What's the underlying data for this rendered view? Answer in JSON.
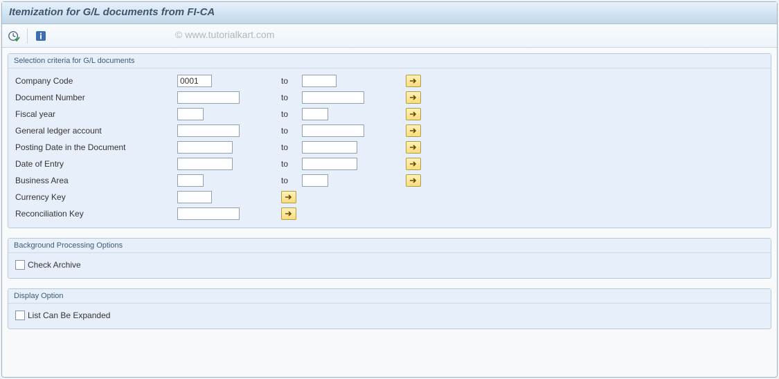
{
  "title": "Itemization for G/L documents from FI-CA",
  "watermark": "© www.tutorialkart.com",
  "toolbar": {
    "execute_tip": "Execute",
    "info_tip": "Information"
  },
  "groups": {
    "selection": {
      "title": "Selection criteria for G/L documents",
      "to_label": "to",
      "rows": {
        "company_code": {
          "label": "Company Code",
          "from": "0001",
          "to": "",
          "has_to": true,
          "has_more": true,
          "from_cls": "w-short",
          "to_cls": "w-short"
        },
        "doc_number": {
          "label": "Document Number",
          "from": "",
          "to": "",
          "has_to": true,
          "has_more": true,
          "from_cls": "w-med",
          "to_cls": "w-med"
        },
        "fiscal_year": {
          "label": "Fiscal year",
          "from": "",
          "to": "",
          "has_to": true,
          "has_more": true,
          "from_cls": "w-year",
          "to_cls": "w-year"
        },
        "gl_account": {
          "label": "General ledger account",
          "from": "",
          "to": "",
          "has_to": true,
          "has_more": true,
          "from_cls": "w-med",
          "to_cls": "w-med"
        },
        "posting_date": {
          "label": "Posting Date in the Document",
          "from": "",
          "to": "",
          "has_to": true,
          "has_more": true,
          "from_cls": "w-mid2",
          "to_cls": "w-mid2"
        },
        "date_of_entry": {
          "label": "Date of Entry",
          "from": "",
          "to": "",
          "has_to": true,
          "has_more": true,
          "from_cls": "w-mid2",
          "to_cls": "w-mid2"
        },
        "business_area": {
          "label": "Business Area",
          "from": "",
          "to": "",
          "has_to": true,
          "has_more": true,
          "from_cls": "w-ba",
          "to_cls": "w-ba"
        },
        "currency_key": {
          "label": "Currency Key",
          "from": "",
          "to": "",
          "has_to": false,
          "has_more": true,
          "has_more_near": true,
          "from_cls": "w-short"
        },
        "recon_key": {
          "label": "Reconciliation Key",
          "from": "",
          "to": "",
          "has_to": false,
          "has_more": true,
          "has_more_near": true,
          "from_cls": "w-med"
        }
      }
    },
    "bg": {
      "title": "Background Processing Options",
      "check_archive_label": "Check Archive",
      "check_archive": false
    },
    "display": {
      "title": "Display Option",
      "expandable_label": "List Can Be Expanded",
      "expandable": false
    }
  }
}
